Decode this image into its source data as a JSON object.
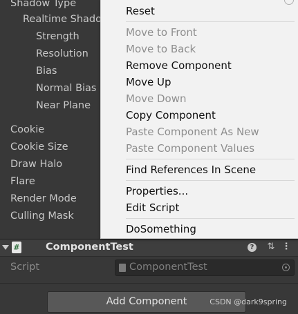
{
  "inspector": {
    "props": {
      "shadow_type": "Shadow Type",
      "realtime_shadows": "Realtime Shado",
      "strength": "Strength",
      "resolution": "Resolution",
      "bias": "Bias",
      "normal_bias": "Normal Bias",
      "near_plane": "Near Plane",
      "cookie": "Cookie",
      "cookie_size": "Cookie Size",
      "draw_halo": "Draw Halo",
      "flare": "Flare",
      "render_mode": "Render Mode",
      "culling_mask": "Culling Mask"
    },
    "component": {
      "title": "ComponentTest",
      "icon_glyph": "#",
      "help_glyph": "?",
      "preset_glyph": "⇅",
      "kebab_glyph": "⋮",
      "script_label": "Script",
      "script_value": "ComponentTest"
    },
    "add_component": "Add Component"
  },
  "context_menu": {
    "items": [
      {
        "label": "Reset",
        "disabled": false
      },
      {
        "label": "Move to Front",
        "disabled": true
      },
      {
        "label": "Move to Back",
        "disabled": true
      },
      {
        "label": "Remove Component",
        "disabled": false
      },
      {
        "label": "Move Up",
        "disabled": false
      },
      {
        "label": "Move Down",
        "disabled": true
      },
      {
        "label": "Copy Component",
        "disabled": false
      },
      {
        "label": "Paste Component As New",
        "disabled": true
      },
      {
        "label": "Paste Component Values",
        "disabled": true
      },
      {
        "label": "Find References In Scene",
        "disabled": false
      },
      {
        "label": "Properties...",
        "disabled": false
      },
      {
        "label": "Edit Script",
        "disabled": false
      },
      {
        "label": "DoSomething",
        "disabled": false
      }
    ]
  },
  "watermark": "CSDN @dark9spring",
  "colors": {
    "inspector_bg": "#383838",
    "menu_bg": "#f2f2f2",
    "menu_disabled_text": "#8e8e8e",
    "button_bg": "#585858"
  }
}
